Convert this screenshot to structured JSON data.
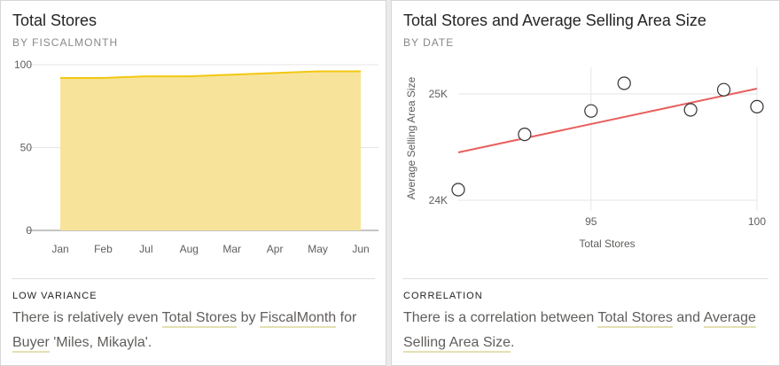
{
  "cards": {
    "left": {
      "title": "Total Stores",
      "subtitle": "BY FISCALMONTH",
      "insight_type": "LOW VARIANCE",
      "insight": {
        "t1": "There is relatively even ",
        "h1": "Total Stores",
        "t2": " by ",
        "h2": "FiscalMonth",
        "t3": " for ",
        "h3": "Buyer",
        "t4": " 'Miles, Mikayla'."
      }
    },
    "right": {
      "title": "Total Stores and Average Selling Area Size",
      "subtitle": "BY DATE",
      "insight_type": "CORRELATION",
      "insight": {
        "t1": "There is a correlation between ",
        "h1": "Total Stores",
        "t2": " and ",
        "h2": "Average Selling Area Size",
        "t3": "."
      }
    }
  },
  "colors": {
    "area_fill": "#f7e49a",
    "area_line": "#f2c811",
    "trend_line": "#e8605d",
    "gridline": "#e6e6e6",
    "baseline": "#8a8886"
  },
  "chart_data": [
    {
      "type": "area",
      "categories": [
        "Jan",
        "Feb",
        "Jul",
        "Aug",
        "Mar",
        "Apr",
        "May",
        "Jun"
      ],
      "series": [
        {
          "values": [
            92,
            92,
            93,
            93,
            94,
            95,
            96,
            96
          ]
        }
      ],
      "yticks": [
        "0",
        "50",
        "100"
      ],
      "ylim": [
        0,
        100
      ],
      "grid": true
    },
    {
      "type": "scatter",
      "xlabel": "Total Stores",
      "ylabel": "Average Selling Area Size",
      "xticks": [
        "95",
        "100"
      ],
      "yticks": [
        "24K",
        "25K"
      ],
      "xlim": [
        91,
        100
      ],
      "ylim": [
        23900,
        25250
      ],
      "points": [
        {
          "x": 91,
          "y": 24100
        },
        {
          "x": 93,
          "y": 24620
        },
        {
          "x": 95,
          "y": 24840
        },
        {
          "x": 96,
          "y": 25100
        },
        {
          "x": 98,
          "y": 24850
        },
        {
          "x": 99,
          "y": 25040
        },
        {
          "x": 100,
          "y": 24880
        }
      ],
      "trend": {
        "x": [
          91,
          100
        ],
        "y": [
          24450,
          25050
        ]
      },
      "grid": true
    }
  ]
}
